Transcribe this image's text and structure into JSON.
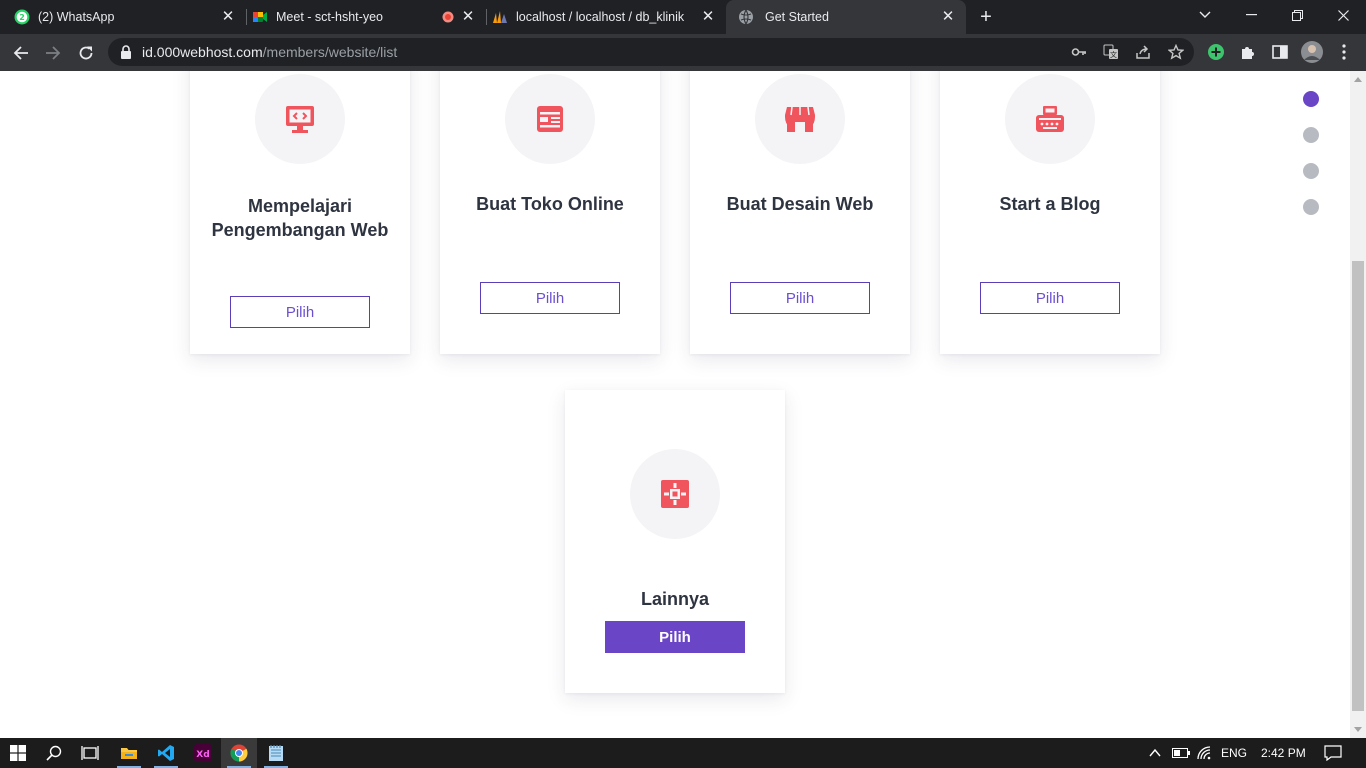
{
  "browser": {
    "tabs": [
      {
        "title": "(2) WhatsApp",
        "icon": "whatsapp-icon",
        "active": false
      },
      {
        "title": "Meet - sct-hsht-yeo",
        "icon": "google-meet-icon",
        "active": false
      },
      {
        "title": "localhost / localhost / db_klinik | ",
        "icon": "phpmyadmin-icon",
        "active": false
      },
      {
        "title": "Get Started",
        "icon": "globe-icon",
        "active": true
      }
    ],
    "url_host": "id.000webhost.com",
    "url_path": "/members/website/list"
  },
  "page": {
    "cards": [
      {
        "title": "Mempelajari Pengembangan Web",
        "button": "Pilih",
        "icon": "monitor-code-icon"
      },
      {
        "title": "Buat Toko Online",
        "button": "Pilih",
        "icon": "online-store-icon"
      },
      {
        "title": "Buat Desain Web",
        "button": "Pilih",
        "icon": "storefront-icon"
      },
      {
        "title": "Start a Blog",
        "button": "Pilih",
        "icon": "typewriter-icon"
      },
      {
        "title": "Lainnya",
        "button": "Pilih",
        "icon": "puzzle-icon",
        "selected": true
      }
    ],
    "step_dots": {
      "count": 4,
      "active_index": 0
    },
    "colors": {
      "accent": "#6a45c5",
      "icon": "#f0545d",
      "dot_inactive": "#b7bbc1"
    }
  },
  "taskbar": {
    "apps": [
      "file-explorer-icon",
      "vscode-icon",
      "adobe-xd-icon",
      "chrome-icon",
      "notepad-icon"
    ],
    "language": "ENG",
    "time": "2:42 PM"
  }
}
